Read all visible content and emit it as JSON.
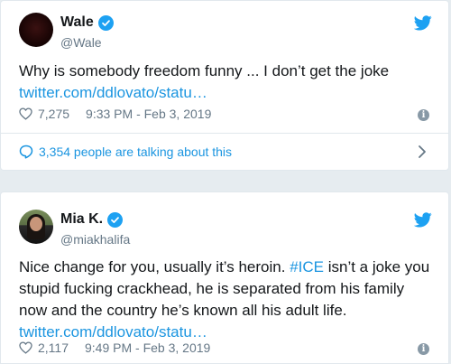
{
  "tweets": [
    {
      "name": "Wale",
      "handle": "@Wale",
      "text": "Why is somebody freedom funny ... I don’t get the joke",
      "link": "twitter.com/ddlovato/statu…",
      "likes": "7,275",
      "time": "9:33 PM - Feb 3, 2019",
      "talking": "3,354 people are talking about this"
    },
    {
      "name": "Mia K.",
      "handle": "@miakhalifa",
      "text_before": "Nice change for you, usually it’s heroin. ",
      "hashtag": "#ICE",
      "text_after": " isn’t a joke you stupid fucking crackhead, he is separated from his family now and the country he’s known all his adult life.",
      "link": "twitter.com/ddlovato/statu…",
      "likes": "2,117",
      "time": "9:49 PM - Feb 3, 2019"
    }
  ],
  "colors": {
    "twitter_blue": "#1da1f2",
    "link_blue": "#1b95e0",
    "muted_gray": "#657786"
  },
  "icons": [
    "verified-badge-icon",
    "twitter-bird-icon",
    "heart-icon",
    "info-icon",
    "speech-bubble-icon",
    "chevron-right-icon"
  ]
}
